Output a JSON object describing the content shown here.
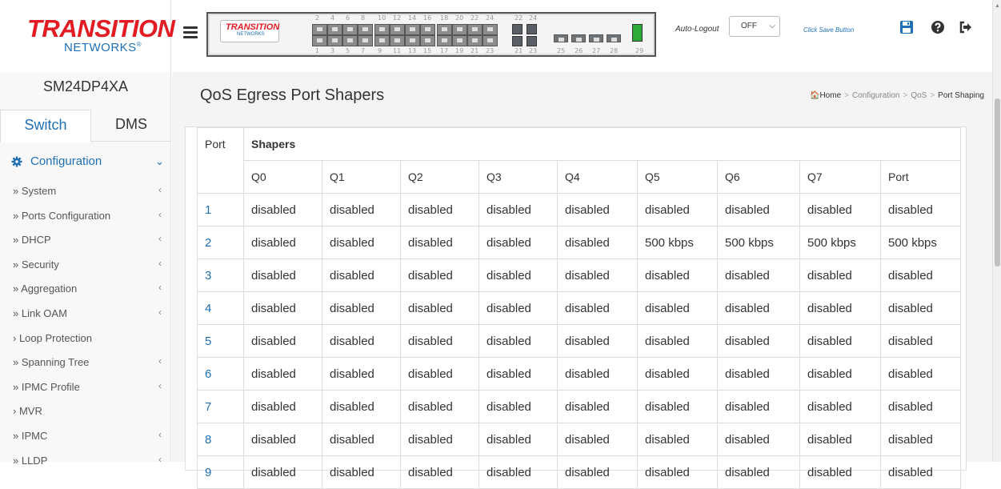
{
  "header": {
    "logo_text": "TRANSITION",
    "logo_sub": "NETWORKS",
    "panel_logo_text": "TRANSITION",
    "panel_logo_sub": "NETWORKS",
    "autologout_label": "Auto-Logout",
    "autologout_value": "OFF",
    "save_link": "Click Save Button",
    "icons": [
      "save-icon",
      "help-icon",
      "logout-icon"
    ],
    "port_numbers_top": [
      "2",
      "4",
      "6",
      "8",
      "10",
      "12",
      "14",
      "16",
      "18",
      "20",
      "22",
      "24",
      "22",
      "24"
    ],
    "port_numbers_bottom": [
      "1",
      "3",
      "5",
      "7",
      "9",
      "11",
      "13",
      "15",
      "17",
      "19",
      "21",
      "23",
      "21",
      "23",
      "25",
      "26",
      "27",
      "28",
      "29"
    ]
  },
  "sidebar": {
    "device_name": "SM24DP4XA",
    "tabs": [
      "Switch",
      "DMS"
    ],
    "section": "Configuration",
    "items": [
      {
        "label": "» System",
        "chevron": true
      },
      {
        "label": "» Ports Configuration",
        "chevron": true
      },
      {
        "label": "» DHCP",
        "chevron": true
      },
      {
        "label": "» Security",
        "chevron": true
      },
      {
        "label": "» Aggregation",
        "chevron": true
      },
      {
        "label": "» Link OAM",
        "chevron": true
      },
      {
        "label": "› Loop Protection",
        "chevron": false
      },
      {
        "label": "» Spanning Tree",
        "chevron": true
      },
      {
        "label": "» IPMC Profile",
        "chevron": true
      },
      {
        "label": "› MVR",
        "chevron": false
      },
      {
        "label": "» IPMC",
        "chevron": true
      },
      {
        "label": "» LLDP",
        "chevron": true
      }
    ]
  },
  "main": {
    "title": "QoS Egress Port Shapers",
    "breadcrumb": {
      "home": "Home",
      "items": [
        "Configuration",
        "QoS"
      ],
      "current": "Port Shaping"
    },
    "table": {
      "port_header": "Port",
      "group_header": "Shapers",
      "columns": [
        "Q0",
        "Q1",
        "Q2",
        "Q3",
        "Q4",
        "Q5",
        "Q6",
        "Q7",
        "Port"
      ],
      "rows": [
        {
          "port": "1",
          "values": [
            "disabled",
            "disabled",
            "disabled",
            "disabled",
            "disabled",
            "disabled",
            "disabled",
            "disabled",
            "disabled"
          ]
        },
        {
          "port": "2",
          "values": [
            "disabled",
            "disabled",
            "disabled",
            "disabled",
            "disabled",
            "500 kbps",
            "500 kbps",
            "500 kbps",
            "500 kbps"
          ]
        },
        {
          "port": "3",
          "values": [
            "disabled",
            "disabled",
            "disabled",
            "disabled",
            "disabled",
            "disabled",
            "disabled",
            "disabled",
            "disabled"
          ]
        },
        {
          "port": "4",
          "values": [
            "disabled",
            "disabled",
            "disabled",
            "disabled",
            "disabled",
            "disabled",
            "disabled",
            "disabled",
            "disabled"
          ]
        },
        {
          "port": "5",
          "values": [
            "disabled",
            "disabled",
            "disabled",
            "disabled",
            "disabled",
            "disabled",
            "disabled",
            "disabled",
            "disabled"
          ]
        },
        {
          "port": "6",
          "values": [
            "disabled",
            "disabled",
            "disabled",
            "disabled",
            "disabled",
            "disabled",
            "disabled",
            "disabled",
            "disabled"
          ]
        },
        {
          "port": "7",
          "values": [
            "disabled",
            "disabled",
            "disabled",
            "disabled",
            "disabled",
            "disabled",
            "disabled",
            "disabled",
            "disabled"
          ]
        },
        {
          "port": "8",
          "values": [
            "disabled",
            "disabled",
            "disabled",
            "disabled",
            "disabled",
            "disabled",
            "disabled",
            "disabled",
            "disabled"
          ]
        },
        {
          "port": "9",
          "values": [
            "disabled",
            "disabled",
            "disabled",
            "disabled",
            "disabled",
            "disabled",
            "disabled",
            "disabled",
            "disabled"
          ]
        }
      ]
    }
  },
  "colors": {
    "accent": "#1e6fb4",
    "brand_red": "#e31b23",
    "port_link_green": "#2eaa3a"
  }
}
